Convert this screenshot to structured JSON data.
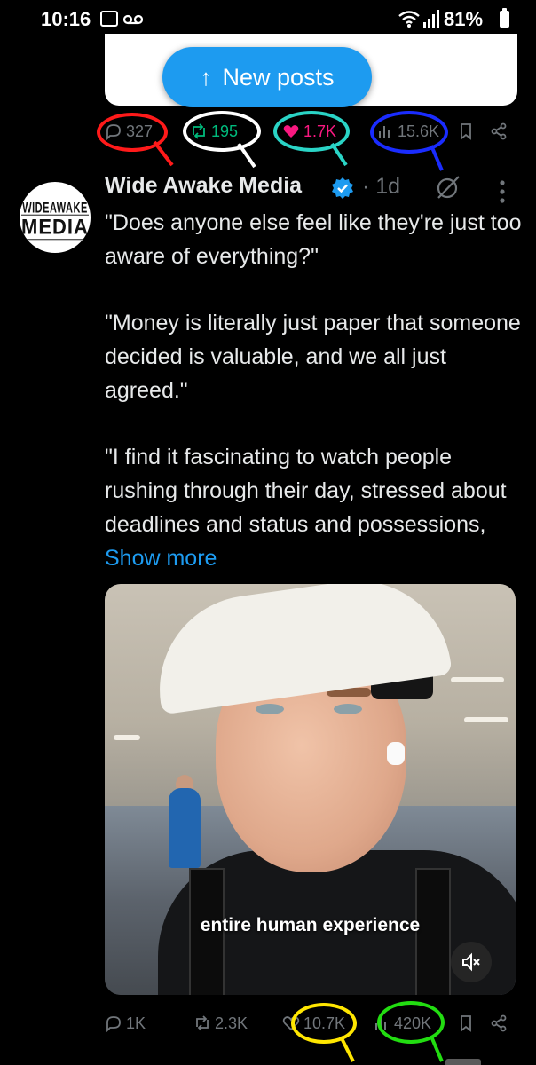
{
  "status_bar": {
    "time": "10:16",
    "battery": "81%"
  },
  "new_posts": {
    "label": "New posts"
  },
  "prev_tweet": {
    "replies": "327",
    "reposts": "195",
    "likes": "1.7K",
    "views": "15.6K"
  },
  "tweet": {
    "author": "Wide Awake Media",
    "avatar_text_top": "WIDEAWAKE",
    "avatar_text_bottom": "MEDIA",
    "time": "· 1d",
    "paragraphs": [
      "\"Does anyone else feel like they're just too aware of everything?\"",
      "\"Money is literally just paper that someone decided is valuable, and we all just agreed.\""
    ],
    "last_paragraph": "\"I find it fascinating to watch people rushing through their day, stressed about deadlines and status and possessions, ",
    "show_more": "Show more",
    "media_caption": "entire human experience",
    "replies": "1K",
    "reposts": "2.3K",
    "likes": "10.7K",
    "views": "420K"
  },
  "colors": {
    "accent": "#1d9bf0",
    "muted": "#71767b",
    "like": "#f91880",
    "repost": "#00ba7c",
    "annotation_red": "#ff1a1a",
    "annotation_white": "#ffffff",
    "annotation_teal": "#2ad4c6",
    "annotation_blue": "#1a2cff",
    "annotation_yellow": "#ffe600",
    "annotation_green": "#22dd11"
  }
}
